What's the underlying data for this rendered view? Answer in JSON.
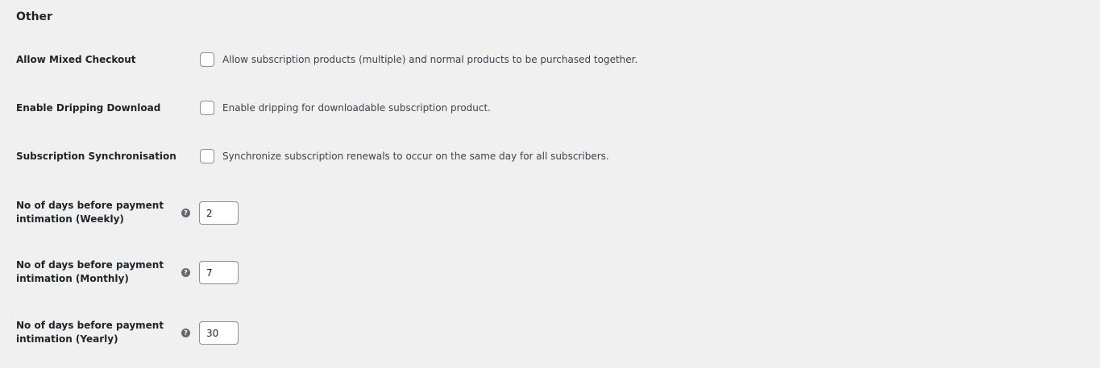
{
  "section": {
    "title": "Other"
  },
  "settings": {
    "mixed_checkout": {
      "label": "Allow Mixed Checkout",
      "description": "Allow subscription products (multiple) and normal products to be purchased together.",
      "checked": false
    },
    "dripping_download": {
      "label": "Enable Dripping Download",
      "description": "Enable dripping for downloadable subscription product.",
      "checked": false
    },
    "synchronisation": {
      "label": "Subscription Synchronisation",
      "description": "Synchronize subscription renewals to occur on the same day for all subscribers.",
      "checked": false
    },
    "weekly_days": {
      "label_line1": "No of days before payment",
      "label_line2": "intimation (Weekly)",
      "value": "2",
      "help_icon": "question-circle-icon"
    },
    "monthly_days": {
      "label_line1": "No of days before payment",
      "label_line2": "intimation (Monthly)",
      "value": "7",
      "help_icon": "question-circle-icon"
    },
    "yearly_days": {
      "label_line1": "No of days before payment",
      "label_line2": "intimation (Yearly)",
      "value": "30",
      "help_icon": "question-circle-icon"
    }
  }
}
